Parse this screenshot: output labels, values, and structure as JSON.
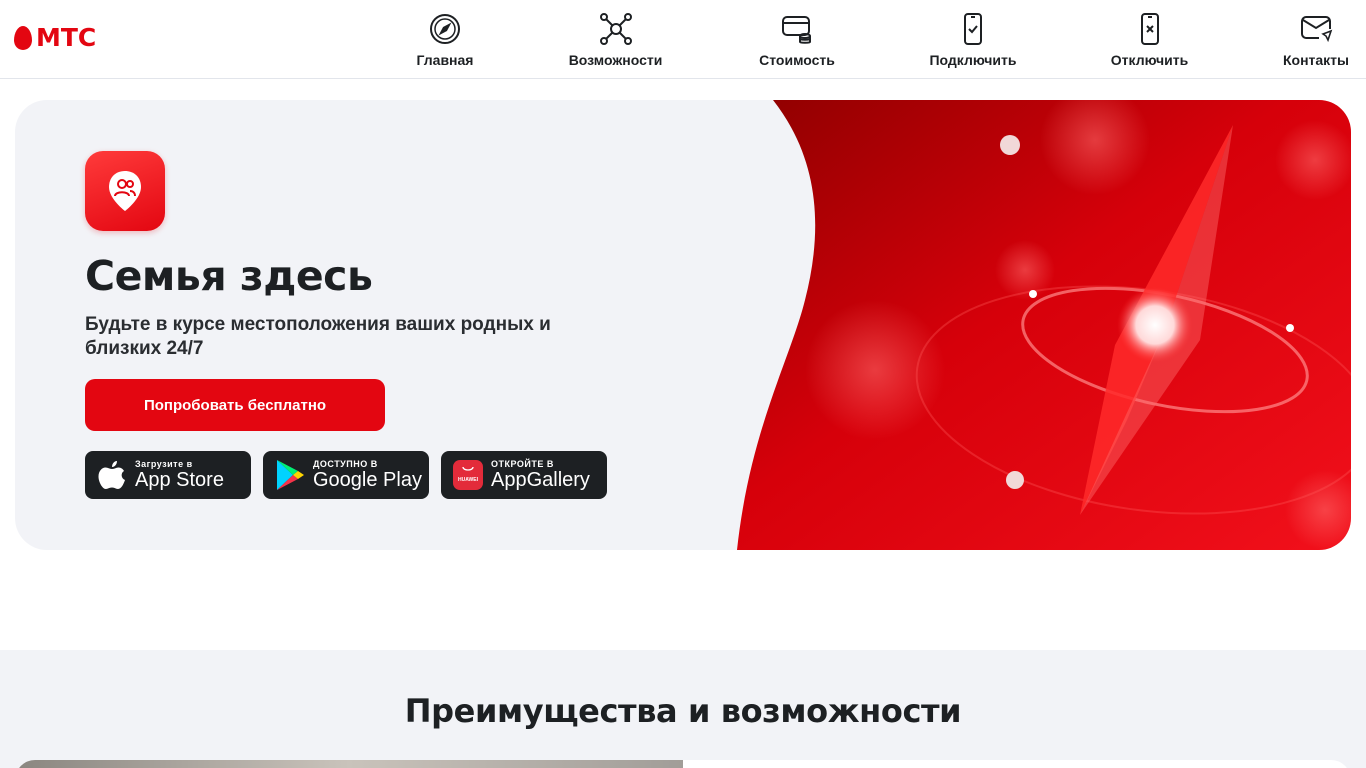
{
  "brand": {
    "logo_text": "МТС",
    "accent": "#e30611"
  },
  "nav": [
    {
      "label": "Главная",
      "icon": "compass-icon"
    },
    {
      "label": "Возможности",
      "icon": "network-nodes-icon"
    },
    {
      "label": "Стоимость",
      "icon": "card-coins-icon"
    },
    {
      "label": "Подключить",
      "icon": "phone-check-icon"
    },
    {
      "label": "Отключить",
      "icon": "phone-cross-icon"
    },
    {
      "label": "Контакты",
      "icon": "mail-send-icon"
    }
  ],
  "hero": {
    "app_icon": "family-location-pin-icon",
    "title": "Семья здесь",
    "subtitle": "Будьте в курсе местоположения ваших родных и близких 24/7",
    "cta_label": "Попробовать бесплатно",
    "stores": [
      {
        "small": "Загрузите в",
        "big": "App Store",
        "icon": "apple-icon"
      },
      {
        "small": "ДОСТУПНО В",
        "big": "Google Play",
        "icon": "google-play-icon"
      },
      {
        "small": "ОТКРОЙТЕ В",
        "big": "AppGallery",
        "icon": "huawei-appgallery-icon",
        "badge": "HUAWEI"
      }
    ]
  },
  "advantages": {
    "title": "Преимущества и возможности"
  }
}
